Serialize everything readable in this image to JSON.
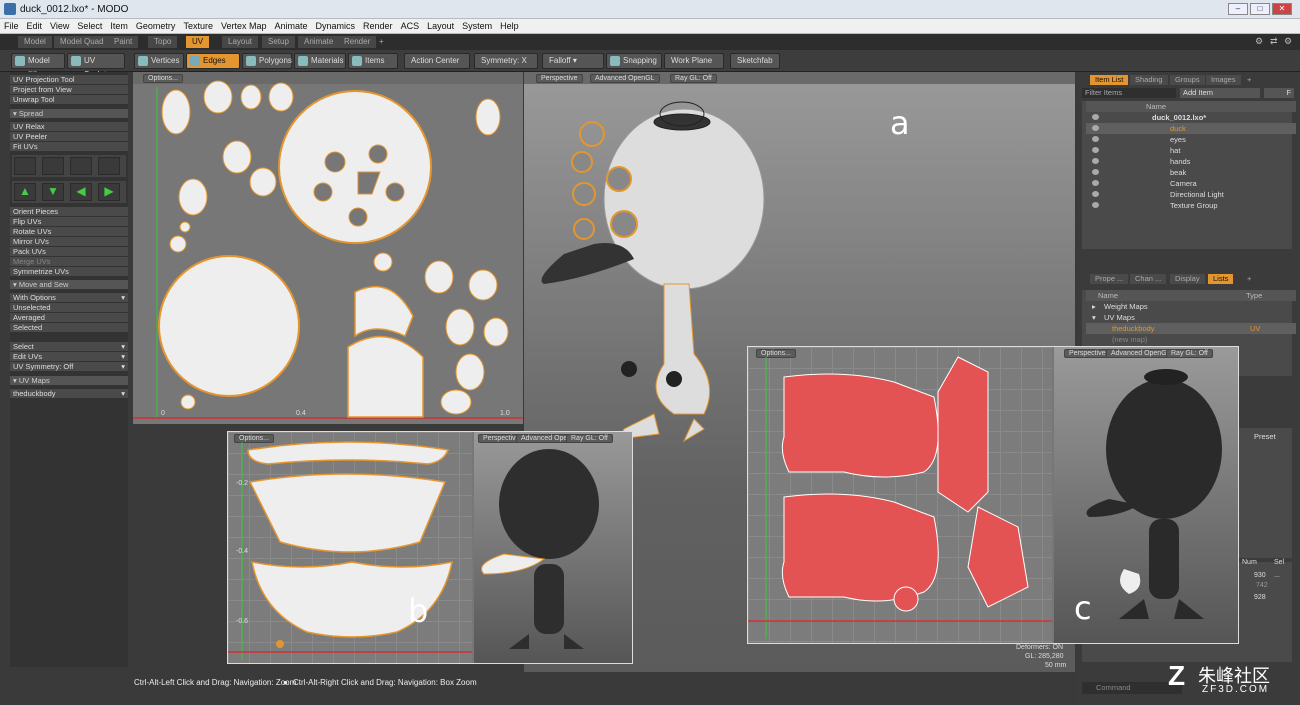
{
  "window": {
    "title": "duck_0012.lxo* - MODO"
  },
  "menu": [
    "File",
    "Edit",
    "View",
    "Select",
    "Item",
    "Geometry",
    "Texture",
    "Vertex Map",
    "Animate",
    "Dynamics",
    "Render",
    "ACS",
    "Layout",
    "System",
    "Help"
  ],
  "layout_tabs": [
    "Model",
    "Model Quad",
    "Paint",
    "Topo",
    "UV",
    "Layout",
    "Setup",
    "Animate",
    "Render",
    "+"
  ],
  "toolbar": {
    "model": "Model",
    "model_key": "F2",
    "uv_sculpt": "UV Sculpt",
    "vertices": "Vertices",
    "edges": "Edges",
    "polygons": "Polygons",
    "materials": "Materials",
    "items": "Items",
    "action_center": "Action Center",
    "symmetry": "Symmetry: X",
    "falloff": "Falloff",
    "snapping": "Snapping",
    "work_plane": "Work Plane",
    "sketchfab": "Sketchfab"
  },
  "left_panel": {
    "tools_a": [
      "UV Projection Tool",
      "Project from View",
      "Unwrap Tool"
    ],
    "spread": "Spread",
    "tools_b": [
      "UV Relax",
      "UV Peeler",
      "Fit UVs"
    ],
    "tools_c": [
      "Orient Pieces",
      "Flip UVs",
      "Rotate UVs",
      "Mirror UVs",
      "Pack UVs",
      "Merge UVs",
      "Symmetrize UVs"
    ],
    "move_sew": "Move and Sew",
    "sew_opts": [
      "With Options",
      "Unselected",
      "Averaged",
      "Selected"
    ],
    "dropdowns": [
      "Select",
      "Edit UVs",
      "UV Symmetry: Off"
    ],
    "uv_maps": "UV Maps",
    "uv_map_value": "theduckbody"
  },
  "uv_view": {
    "options": "Options...",
    "tick_0": "0",
    "tick_04": "0.4",
    "tick_10": "1.0"
  },
  "viewport": {
    "perspective": "Perspective",
    "opengl": "Advanced OpenGL",
    "raygl": "Ray GL: Off",
    "label_a": "a",
    "deformers": "Deformers: ON",
    "gl": "GL: 285,280",
    "focal": "50 mm"
  },
  "right_panel": {
    "tabs": [
      "Item List",
      "Shading",
      "Groups",
      "Images",
      "+"
    ],
    "filter": "Filter Items",
    "add_item": "Add Item",
    "f_key": "F",
    "name_col": "Name",
    "items": [
      {
        "label": "duck_0012.lxo*",
        "indent": 0
      },
      {
        "label": "duck",
        "indent": 1
      },
      {
        "label": "eyes",
        "indent": 1
      },
      {
        "label": "hat",
        "indent": 1
      },
      {
        "label": "hands",
        "indent": 1
      },
      {
        "label": "beak",
        "indent": 1
      },
      {
        "label": "Camera",
        "indent": 1
      },
      {
        "label": "Directional Light",
        "indent": 1
      },
      {
        "label": "Texture Group",
        "indent": 1
      }
    ],
    "tabs2": [
      "Prope ...",
      "Chan ...",
      "Display",
      "Lists",
      "+"
    ],
    "lists_name": "Name",
    "lists_type": "Type",
    "weight_maps": "Weight Maps",
    "uv_maps": "UV Maps",
    "uv_map_item": "theduckbody",
    "uv_type": "UV",
    "new_map": "(new map)",
    "preset": "Preset",
    "num": "Num",
    "sel": "Sel",
    "n1": "930",
    "n2": "742",
    "n3": "928",
    "n4": "...",
    "command": "Command"
  },
  "inset_b": {
    "options": "Options...",
    "perspective": "Perspective",
    "opengl": "Advanced OpenGL",
    "raygl": "Ray GL: Off",
    "label": "b",
    "t1": "-0.2",
    "t2": "-0.4",
    "t3": "-0.6"
  },
  "inset_c": {
    "options": "Options...",
    "perspective": "Perspective",
    "opengl": "Advanced OpenGL",
    "raygl": "Ray GL: Off",
    "label": "c"
  },
  "status": {
    "left": "Ctrl-Alt-Left Click and Drag: Navigation: Zoom",
    "right": "Ctrl-Alt-Right Click and Drag: Navigation: Box Zoom"
  },
  "watermark": {
    "cn": "朱峰社区",
    "url": "ZF3D.COM"
  }
}
